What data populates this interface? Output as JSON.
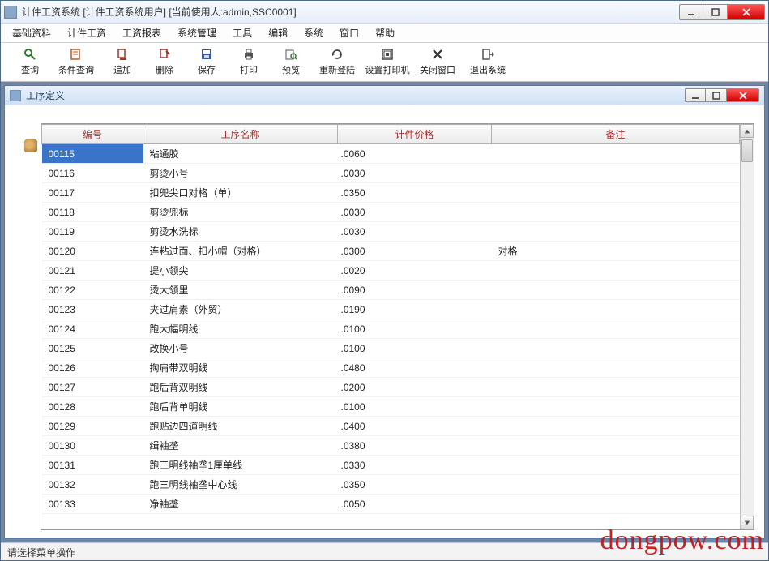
{
  "outer_title": "计件工资系统  [计件工资系统用户]  [当前使用人:admin,SSC0001]",
  "menu": [
    "基础资料",
    "计件工资",
    "工资报表",
    "系统管理",
    "工具",
    "编辑",
    "系统",
    "窗口",
    "帮助"
  ],
  "toolbar": [
    {
      "label": "查询",
      "icon": "search-icon"
    },
    {
      "label": "条件查询",
      "icon": "filter-icon"
    },
    {
      "label": "追加",
      "icon": "append-icon"
    },
    {
      "label": "删除",
      "icon": "delete-icon"
    },
    {
      "label": "保存",
      "icon": "save-icon"
    },
    {
      "label": "打印",
      "icon": "print-icon"
    },
    {
      "label": "预览",
      "icon": "preview-icon"
    },
    {
      "label": "重新登陆",
      "icon": "relogin-icon"
    },
    {
      "label": "设置打印机",
      "icon": "printer-settings-icon"
    },
    {
      "label": "关闭窗口",
      "icon": "close-window-icon"
    },
    {
      "label": "退出系统",
      "icon": "exit-icon"
    }
  ],
  "inner_title": "工序定义",
  "columns": [
    "编号",
    "工序名称",
    "计件价格",
    "备注"
  ],
  "rows": [
    {
      "code": "00115",
      "name": "粘通胶",
      "price": ".0060",
      "note": ""
    },
    {
      "code": "00116",
      "name": "剪烫小号",
      "price": ".0030",
      "note": ""
    },
    {
      "code": "00117",
      "name": "扣兜尖口对格（单）",
      "price": ".0350",
      "note": ""
    },
    {
      "code": "00118",
      "name": "剪烫兜标",
      "price": ".0030",
      "note": ""
    },
    {
      "code": "00119",
      "name": "剪烫水洗标",
      "price": ".0030",
      "note": ""
    },
    {
      "code": "00120",
      "name": "连粘过面、扣小帽（对格）",
      "price": ".0300",
      "note": "对格"
    },
    {
      "code": "00121",
      "name": "提小领尖",
      "price": ".0020",
      "note": ""
    },
    {
      "code": "00122",
      "name": "烫大领里",
      "price": ".0090",
      "note": ""
    },
    {
      "code": "00123",
      "name": "夹过肩素（外贸）",
      "price": ".0190",
      "note": ""
    },
    {
      "code": "00124",
      "name": "跑大幅明线",
      "price": ".0100",
      "note": ""
    },
    {
      "code": "00125",
      "name": "改换小号",
      "price": ".0100",
      "note": ""
    },
    {
      "code": "00126",
      "name": "掏肩带双明线",
      "price": ".0480",
      "note": ""
    },
    {
      "code": "00127",
      "name": "跑后背双明线",
      "price": ".0200",
      "note": ""
    },
    {
      "code": "00128",
      "name": "跑后背单明线",
      "price": ".0100",
      "note": ""
    },
    {
      "code": "00129",
      "name": "跑贴边四道明线",
      "price": ".0400",
      "note": ""
    },
    {
      "code": "00130",
      "name": "缉袖垄",
      "price": ".0380",
      "note": ""
    },
    {
      "code": "00131",
      "name": "跑三明线袖垄1厘单线",
      "price": ".0330",
      "note": ""
    },
    {
      "code": "00132",
      "name": "跑三明线袖垄中心线",
      "price": ".0350",
      "note": ""
    },
    {
      "code": "00133",
      "name": "净袖垄",
      "price": ".0050",
      "note": ""
    }
  ],
  "status_text": "请选择菜单操作",
  "watermark": "dongpow.com"
}
